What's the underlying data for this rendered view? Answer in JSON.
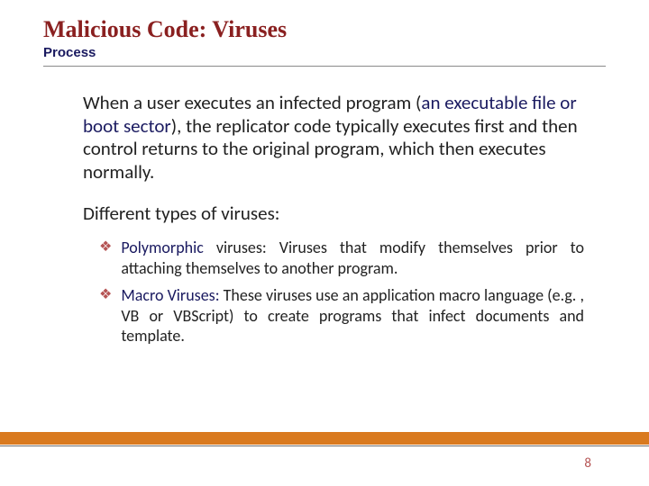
{
  "title": "Malicious Code: Viruses",
  "subtitle": "Process",
  "para1_pre": "When a user executes an infected program (",
  "para1_paren": "an executable file or boot sector",
  "para1_post": "), the replicator code typically executes first and then control returns to the original program, which then executes normally.",
  "para2": "Different types of viruses:",
  "bullets": [
    {
      "lead": "Polymorphic",
      "rest": " viruses: Viruses that modify themselves prior to attaching themselves to another program."
    },
    {
      "lead": "Macro Viruses:",
      "rest": " These viruses use an application macro language (e.g. , VB or VBScript) to create programs that infect documents and template."
    }
  ],
  "page": "8",
  "diamond_glyph": "❖"
}
